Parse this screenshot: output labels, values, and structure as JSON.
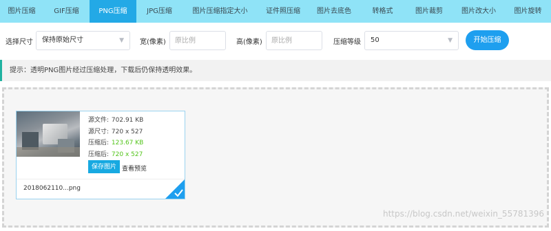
{
  "tabs": [
    {
      "label": "图片压缩",
      "active": false
    },
    {
      "label": "GIF压缩",
      "active": false
    },
    {
      "label": "PNG压缩",
      "active": true
    },
    {
      "label": "JPG压缩",
      "active": false
    },
    {
      "label": "图片压缩指定大小",
      "active": false
    },
    {
      "label": "证件照压缩",
      "active": false
    },
    {
      "label": "图片去底色",
      "active": false
    },
    {
      "label": "转格式",
      "active": false
    },
    {
      "label": "图片裁剪",
      "active": false
    },
    {
      "label": "图片改大小",
      "active": false
    },
    {
      "label": "图片旋转",
      "active": false
    }
  ],
  "toolbar": {
    "size_label": "选择尺寸",
    "size_value": "保持原始尺寸",
    "width_label": "宽(像素)",
    "width_placeholder": "原比例",
    "height_label": "高(像素)",
    "height_placeholder": "原比例",
    "quality_label": "压缩等级",
    "quality_value": "50",
    "start_label": "开始压缩"
  },
  "notice": {
    "text": "提示：透明PNG图片经过压缩处理，下载后仍保持透明效果。"
  },
  "file_card": {
    "source_size_label": "源文件:",
    "source_size_value": "702.91 KB",
    "source_dim_label": "源尺寸:",
    "source_dim_value": "720 x 527",
    "compressed_size_label": "压缩后:",
    "compressed_size_value": "123.67 KB",
    "compressed_dim_label": "压缩后:",
    "compressed_dim_value": "720 x 527",
    "save_label": "保存图片",
    "preview_label": "查看预览",
    "filename": "2018062110...png",
    "selected": true
  },
  "watermark": "https://blog.csdn.net/weixin_55781396",
  "colors": {
    "tab_bar": "#8fe3f7",
    "tab_active": "#23a9e6",
    "primary_button": "#1e9fef",
    "notice_border": "#20b2a0",
    "success_text": "#52c41a"
  }
}
